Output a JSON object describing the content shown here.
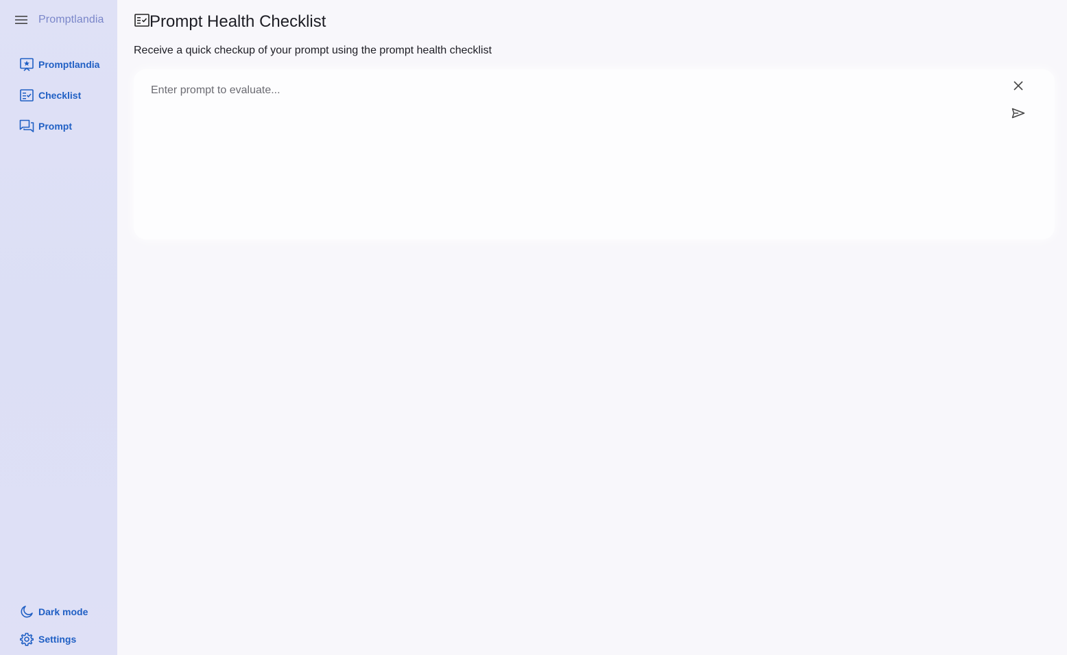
{
  "sidebar": {
    "brand": "Promptlandia",
    "items": [
      {
        "label": "Promptlandia",
        "icon": "featured-play-list-icon"
      },
      {
        "label": "Checklist",
        "icon": "fact-check-icon"
      },
      {
        "label": "Prompt",
        "icon": "forum-icon"
      }
    ],
    "bottom": [
      {
        "label": "Dark mode",
        "icon": "moon-icon"
      },
      {
        "label": "Settings",
        "icon": "gear-icon"
      }
    ]
  },
  "main": {
    "title": "Prompt Health Checklist",
    "title_icon": "fact-check-icon",
    "subtitle": "Receive a quick checkup of your prompt using the prompt health checklist",
    "prompt": {
      "placeholder": "Enter prompt to evaluate...",
      "value": ""
    }
  },
  "colors": {
    "accent": "#1f5fc4",
    "brand": "#7a86c9",
    "sidebar_bg": "#dfe1f6",
    "page_bg": "#f8f7fb"
  }
}
